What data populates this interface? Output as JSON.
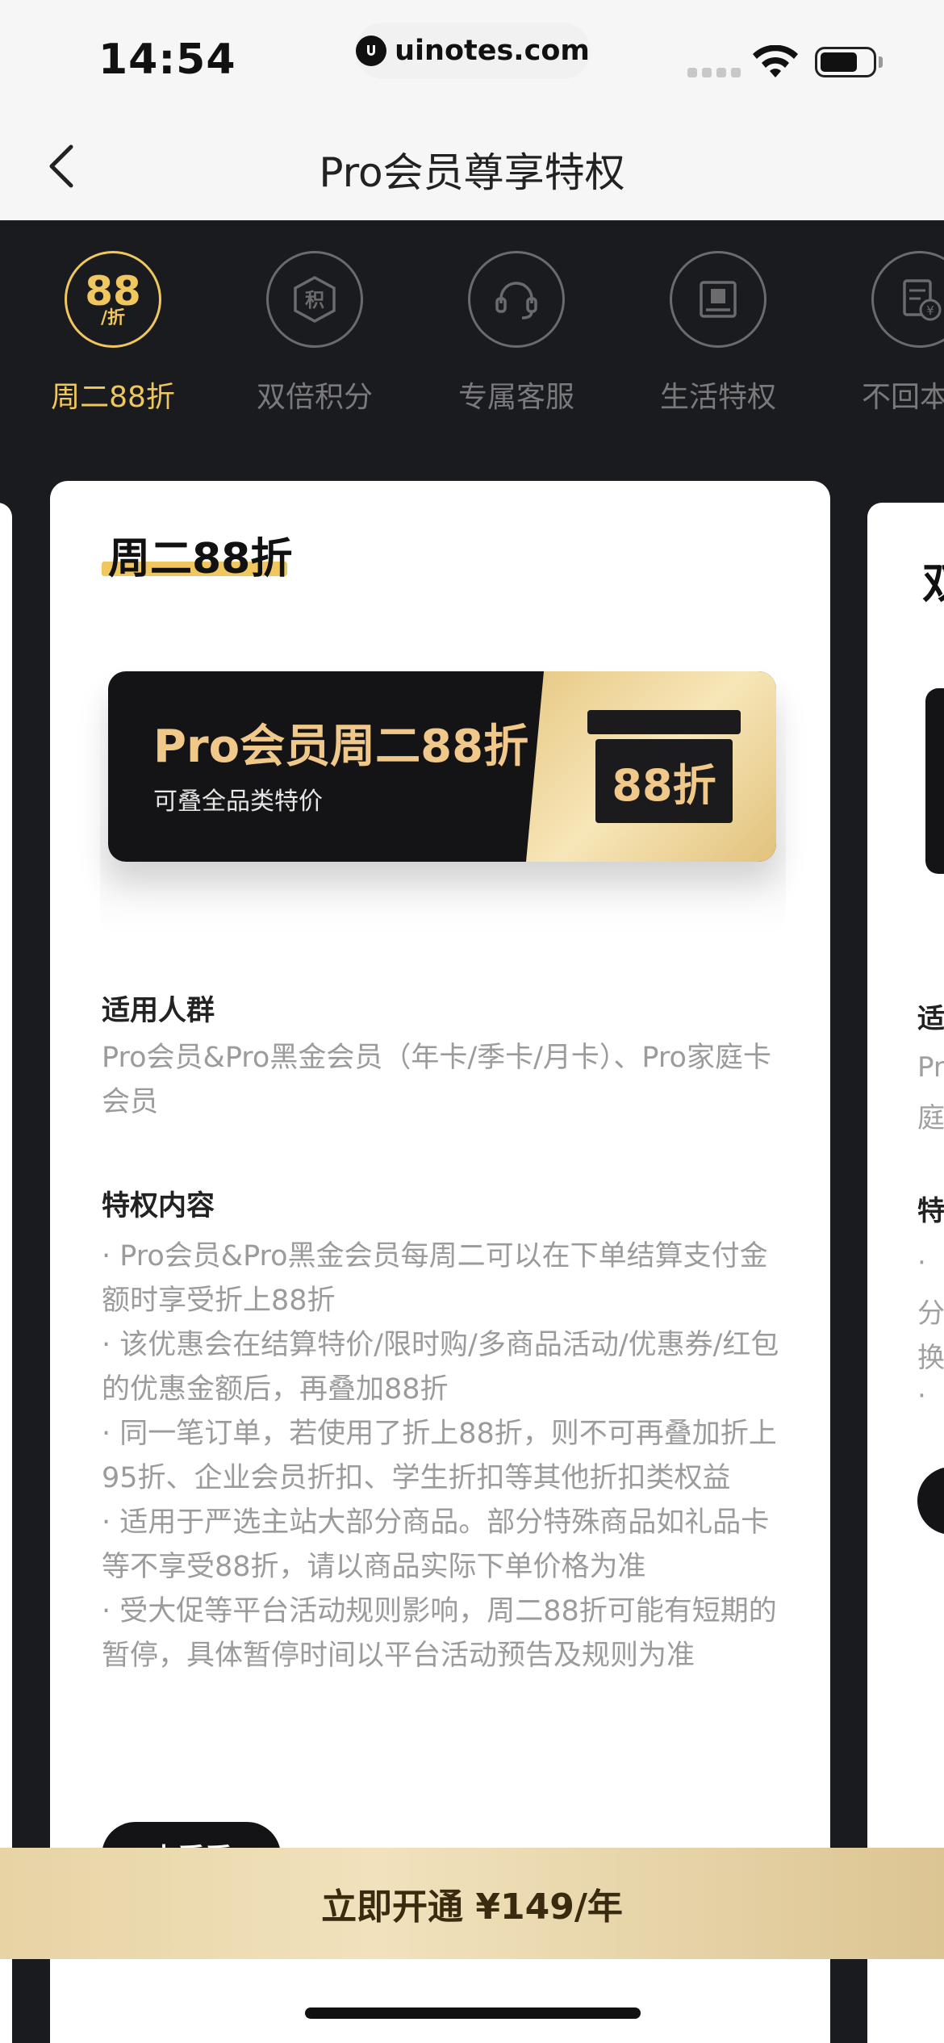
{
  "status_bar": {
    "time": "14:54",
    "url": "uinotes.com"
  },
  "nav": {
    "title": "Pro会员尊享特权"
  },
  "tabs": [
    {
      "label": "周二88折",
      "icon": "discount-88-icon",
      "badge_big": "88",
      "badge_small": "/折",
      "active": true
    },
    {
      "label": "双倍积分",
      "icon": "points-icon",
      "badge": "积",
      "active": false
    },
    {
      "label": "专属客服",
      "icon": "headset-icon",
      "active": false
    },
    {
      "label": "生活特权",
      "icon": "box-icon",
      "active": false
    },
    {
      "label": "不回本退",
      "icon": "refund-icon",
      "active": false
    }
  ],
  "card": {
    "title": "周二88折",
    "banner": {
      "title": "Pro会员周二88折",
      "subtitle": "可叠全品类特价",
      "box_text": "88折"
    },
    "audience_heading": "适用人群",
    "audience_text": "Pro会员&Pro黑金会员（年卡/季卡/月卡）、Pro家庭卡会员",
    "content_heading": "特权内容",
    "content_items": [
      "· Pro会员&Pro黑金会员每周二可以在下单结算支付金额时享受折上88折",
      "· 该优惠会在结算特价/限时购/多商品活动/优惠券/红包的优惠金额后，再叠加88折",
      "· 同一笔订单，若使用了折上88折，则不可再叠加折上95折、企业会员折扣、学生折扣等其他折扣类权益",
      "· 适用于严选主站大部分商品。部分特殊商品如礼品卡等不享受88折，请以商品实际下单价格为准",
      "· 受大促等平台活动规则影响，周二88折可能有短期的暂停，具体暂停时间以平台活动预告及规则为准"
    ],
    "action_label": "去看看"
  },
  "next_card": {
    "title": "双",
    "audience_heading": "适",
    "audience_lines": [
      "Pr",
      "庭"
    ],
    "content_heading": "特",
    "content_lines": [
      "·",
      "分",
      "换",
      "·"
    ]
  },
  "cta": {
    "label": "立即开通 ¥149/年"
  },
  "colors": {
    "gold": "#f0c75e",
    "dark_bg": "#1a1b1f",
    "cta_gold": "#e7d3a4"
  }
}
